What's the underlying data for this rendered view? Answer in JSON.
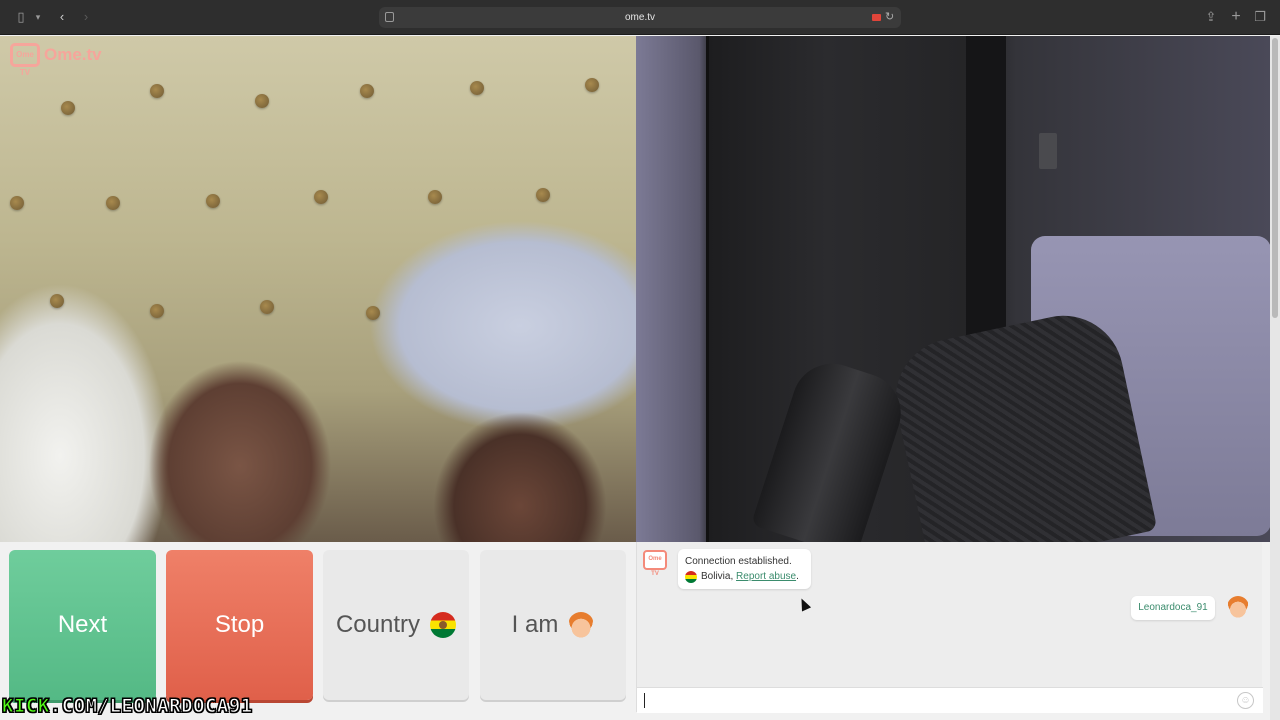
{
  "browser": {
    "url": "ome.tv",
    "sidebar_icon": "sidebar-icon",
    "back_icon": "chevron-left-icon",
    "forward_icon": "chevron-right-icon",
    "share_icon": "share-icon",
    "new_tab_icon": "plus-icon",
    "tabs_icon": "tabs-icon"
  },
  "logo": {
    "badge": "Ome TV",
    "text": "Ome.tv"
  },
  "controls": {
    "next_label": "Next",
    "stop_label": "Stop",
    "country_label": "Country",
    "iam_label": "I am"
  },
  "chat": {
    "system_line1": "Connection established.",
    "country": "Bolivia,",
    "report_link": "Report abuse",
    "report_suffix": ".",
    "user_name": "Leonardoca_91"
  },
  "watermark": {
    "part1": "KICK",
    "part2": ".COM/LEONARDOCA91"
  },
  "colors": {
    "next": "#5cc18f",
    "stop": "#e66a53",
    "neutral": "#e9e9e9",
    "link": "#3b8c6d",
    "brand": "#f48a7a",
    "watermark": "#53fc18"
  }
}
